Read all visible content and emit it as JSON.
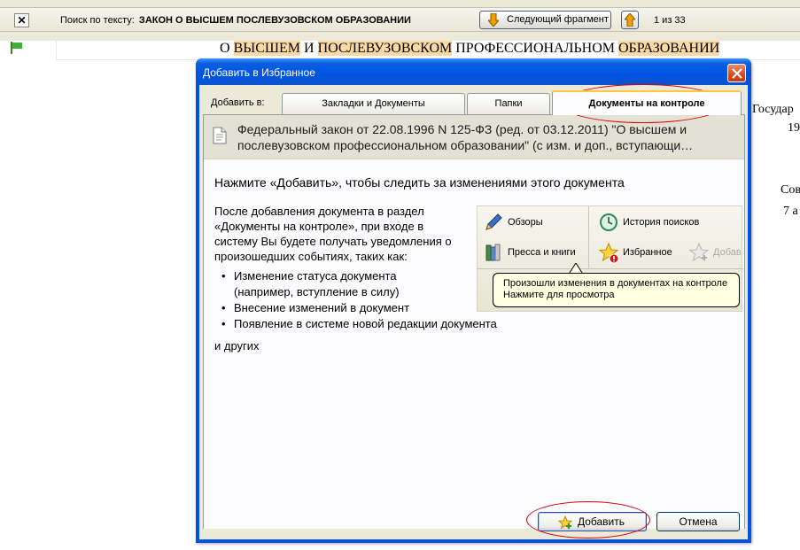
{
  "search_bar": {
    "close_glyph": "✕",
    "label": "Поиск по тексту:",
    "query": "ЗАКОН О ВЫСШЕМ ПОСЛЕВУЗОВСКОМ ОБРАЗОВАНИИ",
    "next_button": "Следующий фрагмент",
    "counter": "1 из 33"
  },
  "document": {
    "title_parts": [
      "О ",
      "ВЫСШЕМ",
      " И ",
      "ПОСЛЕВУЗОВСКОМ",
      " ПРОФЕССИОНАЛЬНОМ ",
      "ОБРАЗОВАНИИ"
    ],
    "side_text": [
      "Государ",
      "19",
      "Сов",
      "7 а"
    ]
  },
  "dialog": {
    "title": "Добавить в Избранное",
    "add_to_label": "Добавить в:",
    "tabs": [
      "Закладки и Документы",
      "Папки",
      "Документы на контроле"
    ],
    "active_tab": 2,
    "doc_info": "Федеральный закон от 22.08.1996 N 125-ФЗ (ред. от 03.12.2011) \"О высшем и послевузовском профессиональном образовании\" (с изм. и доп., вступающи…",
    "heading": "Нажмите «Добавить», чтобы следить за изменениями этого документа",
    "paragraph": "После добавления документа в раздел «Документы на контроле», при входе в систему Вы будете получать уведомления о произошедших событиях, таких как:",
    "bullets": [
      "Изменение статуса документа",
      "(например, вступление в силу)",
      "Внесение изменений в документ",
      "Появление в системе новой редакции документа"
    ],
    "others": "и других",
    "illustration": {
      "reviews": "Обзоры",
      "search_history": "История поисков",
      "press": "Пресса и книги",
      "favorites": "Избранное",
      "add_dim": "Добав"
    },
    "balloon": [
      "Произошли изменения в документах на контроле",
      "Нажмите для просмотра"
    ],
    "add_button": "Добавить",
    "cancel_button": "Отмена"
  },
  "colors": {
    "highlight": "#fbd9a4",
    "titlebar": "#0054e3",
    "annotation": "#d60000"
  }
}
